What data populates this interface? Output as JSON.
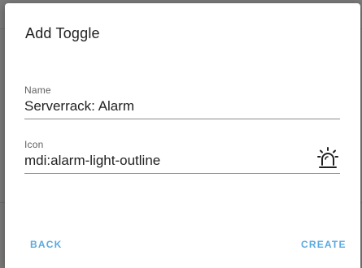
{
  "dialog": {
    "title": "Add Toggle",
    "name_field": {
      "label": "Name",
      "value": "Serverrack: Alarm"
    },
    "icon_field": {
      "label": "Icon",
      "value": "mdi:alarm-light-outline",
      "preview_icon": "alarm-light-outline-icon"
    },
    "actions": {
      "back_label": "BACK",
      "create_label": "CREATE"
    }
  },
  "colors": {
    "accent": "#5aa9e0",
    "backdrop": "#7a7a7a",
    "text": "#212121",
    "label": "#616161"
  }
}
